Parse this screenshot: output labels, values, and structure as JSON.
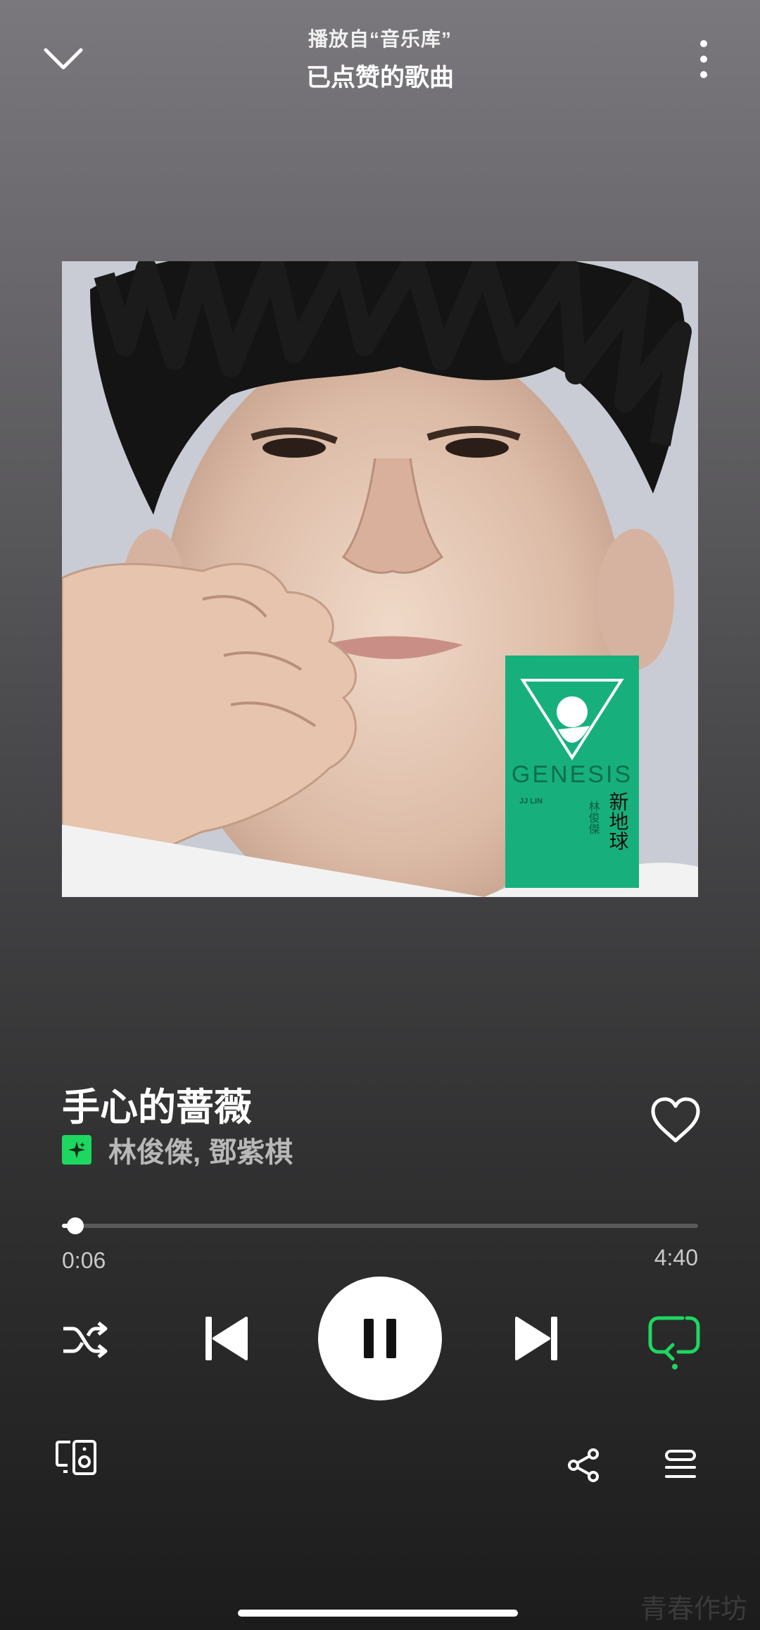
{
  "header": {
    "subtitle": "播放自“音乐库”",
    "title": "已点赞的歌曲",
    "collapse_icon": "chevron-down-icon",
    "more_icon": "more-vertical-icon"
  },
  "album_art": {
    "cover_title": "GENESIS",
    "cover_artist_en": "JJ LIN",
    "cover_title_zh": "新地球",
    "cover_artist_zh": "林俊傑",
    "accent_color": "#17b07c"
  },
  "track": {
    "title": "手心的蔷薇",
    "artist": "林俊傑, 鄧紫棋",
    "liked": true
  },
  "playback": {
    "elapsed": "0:06",
    "total": "4:40",
    "progress_fraction": 0.021,
    "state": "playing",
    "repeat": "on",
    "shuffle": "off"
  },
  "colors": {
    "accent": "#1ed760",
    "text_secondary": "#b8b8b8"
  },
  "watermark": "青春作坊"
}
